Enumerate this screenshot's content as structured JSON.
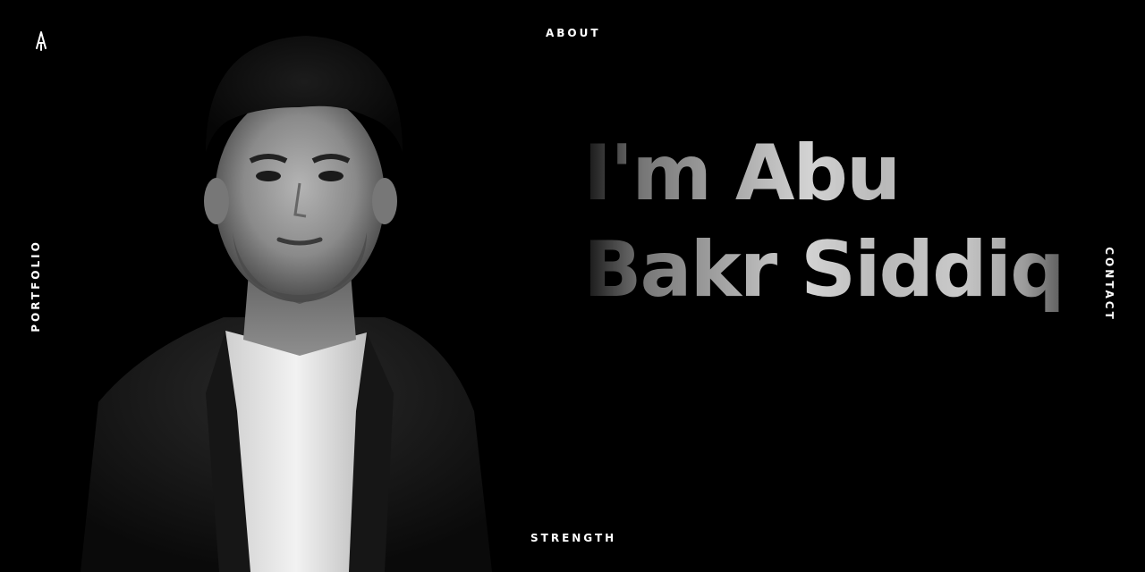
{
  "nav": {
    "about": "ABOUT",
    "strength": "STRENGTH",
    "portfolio": "PORTFOLIO",
    "contact": "CONTACT"
  },
  "hero": {
    "line1": "I'm Abu",
    "line2": "Bakr Siddiq"
  },
  "colors": {
    "background": "#000000",
    "text": "#ffffff"
  }
}
